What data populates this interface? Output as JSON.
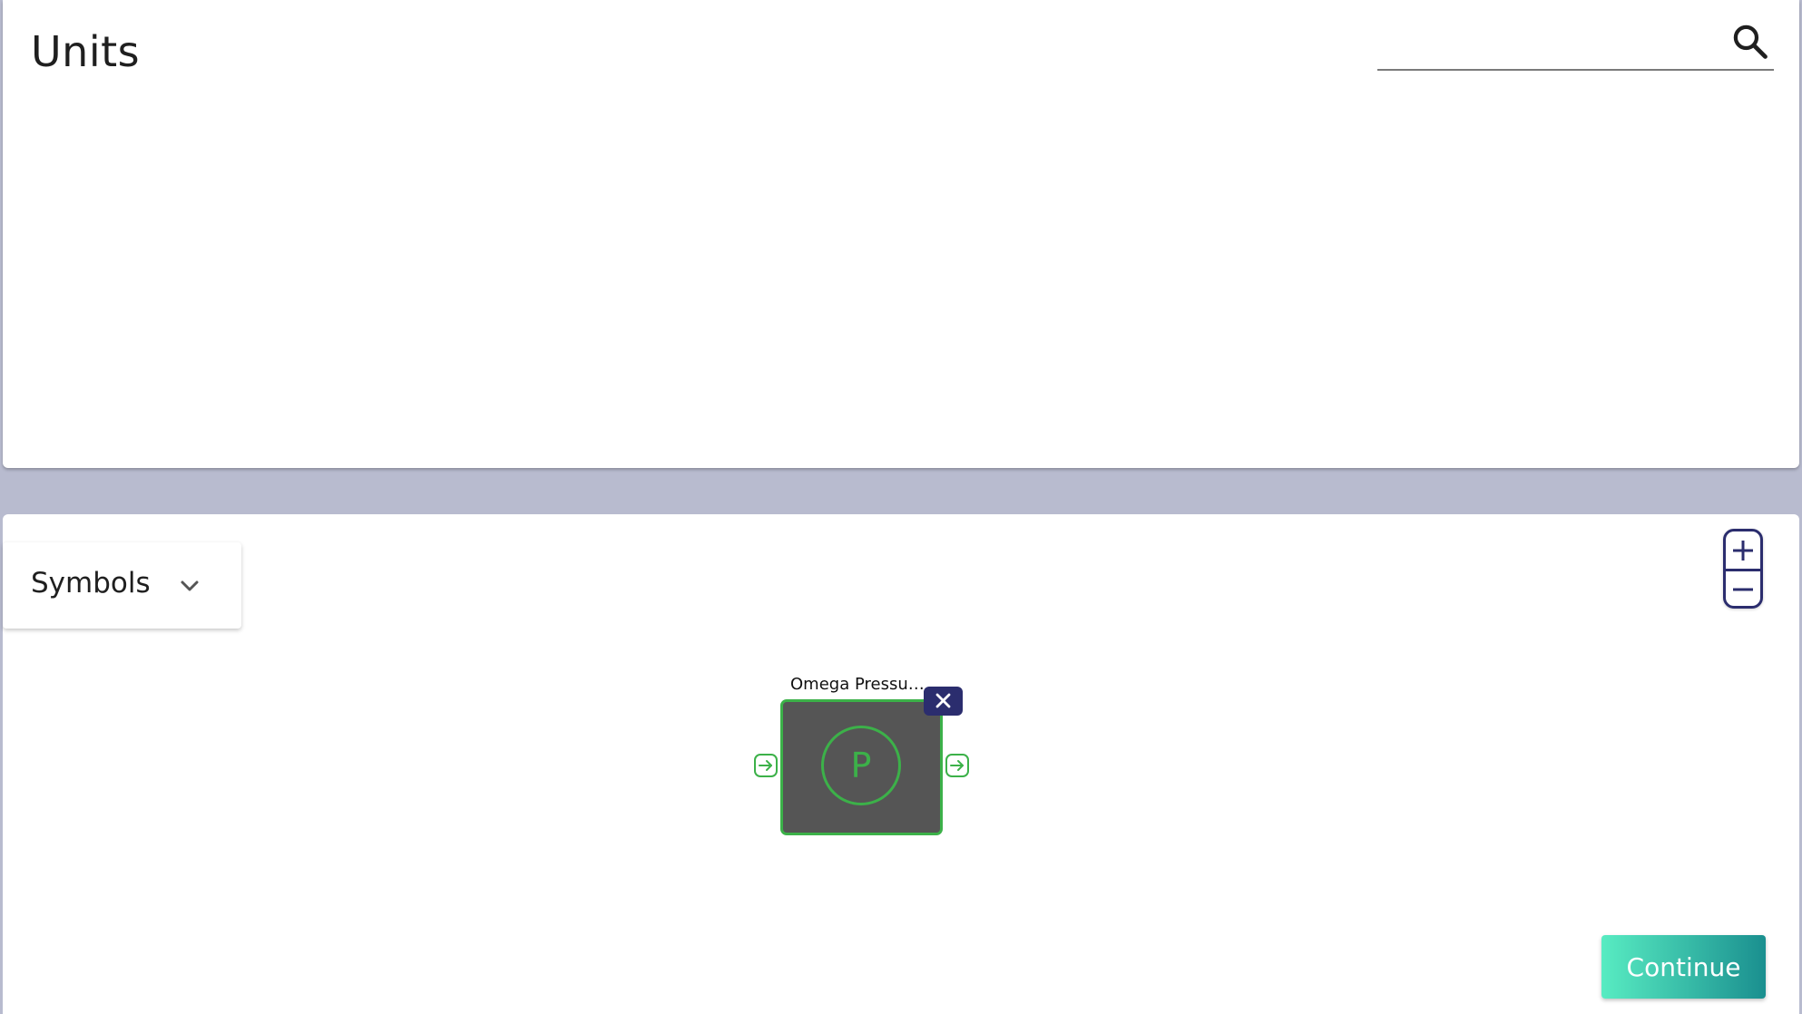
{
  "units_panel": {
    "title": "Units",
    "search": {
      "value": "",
      "placeholder": "",
      "icon": "search-icon"
    }
  },
  "canvas": {
    "symbols_dropdown": {
      "label": "Symbols",
      "icon": "chevron-down-icon"
    },
    "zoom": {
      "in_icon": "plus-icon",
      "out_icon": "minus-icon"
    },
    "node": {
      "title": "Omega Pressur...",
      "symbol_letter": "P",
      "close_icon": "close-icon",
      "input_port_icon": "arrow-right-box-icon",
      "output_port_icon": "arrow-right-box-icon"
    },
    "continue_label": "Continue"
  },
  "colors": {
    "accent_navy": "#2b2d6e",
    "node_green": "#3cb149",
    "node_fill": "#555555",
    "continue_gradient_start": "#58ecc2",
    "continue_gradient_end": "#1a8f8f",
    "divider_background": "#b8bbcf"
  }
}
